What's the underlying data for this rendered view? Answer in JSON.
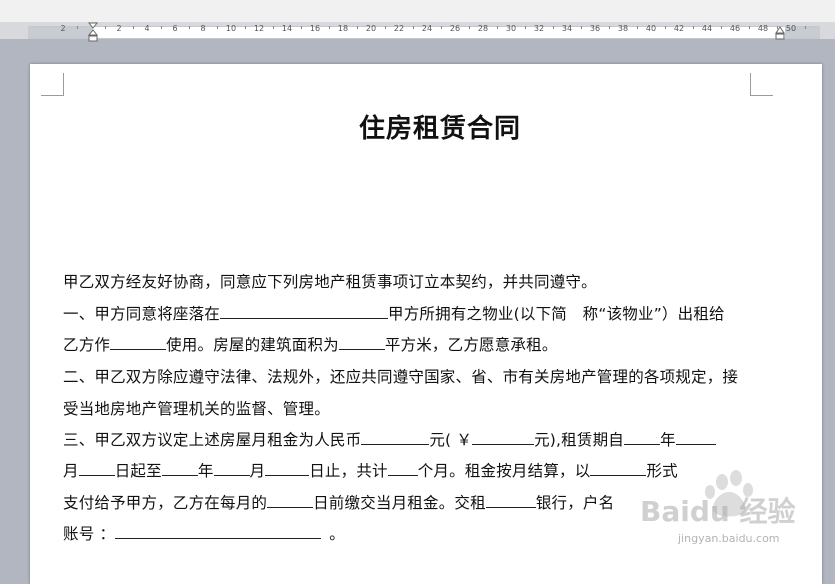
{
  "ruler": {
    "labels": [
      "2",
      "",
      "2",
      "4",
      "6",
      "8",
      "10",
      "12",
      "14",
      "16",
      "18",
      "20",
      "22",
      "24",
      "26",
      "28",
      "30",
      "32",
      "34",
      "36",
      "38",
      "40",
      "42",
      "44",
      "46",
      "48",
      "50"
    ]
  },
  "document": {
    "title": "住房租赁合同",
    "lines": {
      "l1": "甲乙双方经友好协商，同意应下列房地产租赁事项订立本契约，并共同遵守。",
      "l2a": "一、甲方同意将座落在",
      "l2b": "甲方所拥有之物业(以下简　称“该物业”）出租给",
      "l3a": "乙方作",
      "l3b": "使用。房屋的建筑面积为",
      "l3c": "平方米，乙方愿意承租。",
      "l4": "二、甲乙双方除应遵守法律、法规外，还应共同遵守国家、省、市有关房地产管理的各项规定，接",
      "l5": "受当地房地产管理机关的监督、管理。",
      "l6a": "三、甲乙双方议定上述房屋月租金为人民币",
      "l6b": "元( ￥",
      "l6c": "元),租赁期自",
      "l6d": "年",
      "l7a": "月",
      "l7b": "日起至",
      "l7c": "年",
      "l7d": "月",
      "l7e": "日止，共计",
      "l7f": "个月。租金按月结算，以",
      "l7g": "形式",
      "l8a": "支付给予甲方，乙方在每月的",
      "l8b": "日前缴交当月租金。交租",
      "l8c": "银行，户名",
      "l9a": "账号 ：",
      "l9b": "。"
    }
  },
  "watermark": {
    "text": "Baidu 经验",
    "url": "jingyan.baidu.com"
  }
}
